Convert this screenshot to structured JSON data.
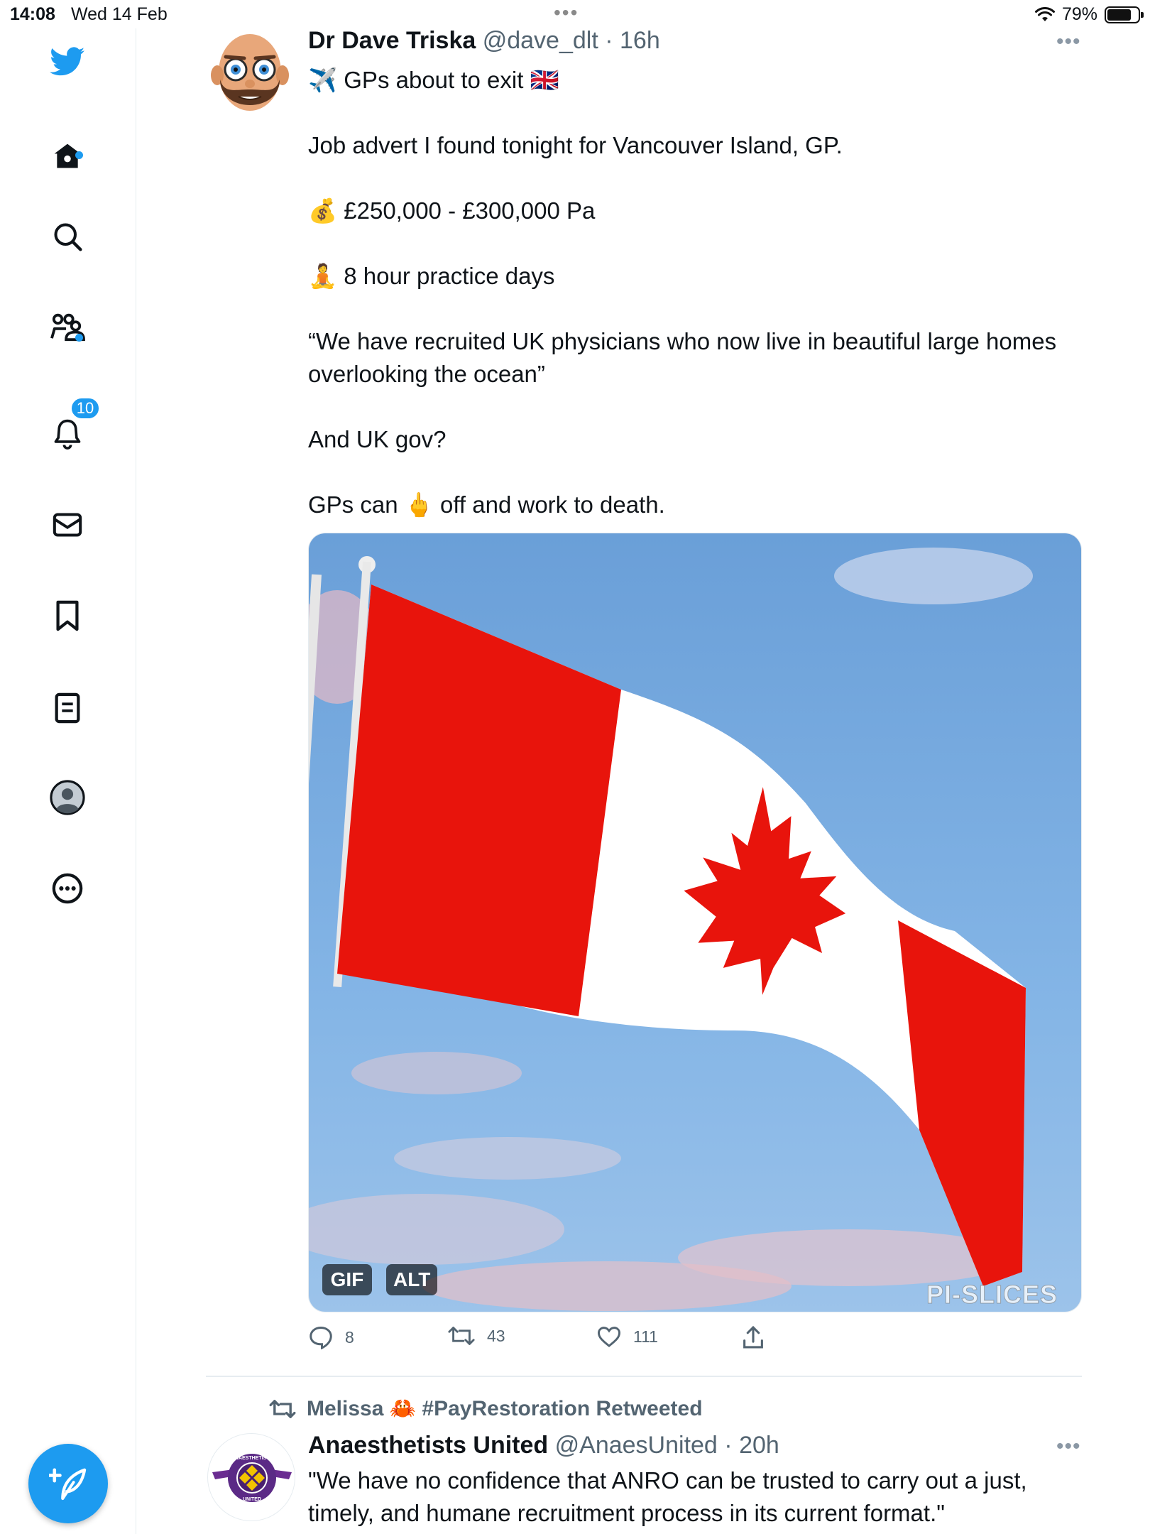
{
  "status_bar": {
    "time": "14:08",
    "date": "Wed 14 Feb",
    "battery": "79%",
    "battery_level": 0.79
  },
  "sidebar": {
    "items": [
      {
        "name": "home",
        "icon": "home-icon"
      },
      {
        "name": "explore",
        "icon": "search-icon"
      },
      {
        "name": "communities",
        "icon": "communities-icon"
      },
      {
        "name": "notifications",
        "icon": "bell-icon",
        "badge": "10"
      },
      {
        "name": "messages",
        "icon": "mail-icon"
      },
      {
        "name": "bookmarks",
        "icon": "bookmark-icon"
      },
      {
        "name": "lists",
        "icon": "list-icon"
      },
      {
        "name": "profile",
        "icon": "profile-icon"
      },
      {
        "name": "more",
        "icon": "more-circle-icon"
      }
    ],
    "accent": "#1d9bf0"
  },
  "tweet1": {
    "name": "Dr Dave Triska",
    "handle": "@dave_dlt",
    "time": "16h",
    "lines": {
      "l1_emoji": "✈️",
      "l1_text": "GPs about to exit",
      "l1_flag": "🇬🇧",
      "l2": "Job advert I found tonight for Vancouver Island, GP.",
      "l3_emoji": "💰",
      "l3_text": "£250,000 - £300,000 Pa",
      "l4_emoji": "🧘",
      "l4_text": "8 hour practice days",
      "l5": "“We have recruited UK physicians who now live in beautiful large homes overlooking the ocean”",
      "l6": "And UK gov?",
      "l7_a": "GPs can",
      "l7_emoji": "🖕",
      "l7_b": "off and work to death."
    },
    "media": {
      "tag_gif": "GIF",
      "tag_alt": "ALT",
      "watermark": "PI-SLICES"
    },
    "stats": {
      "replies": "8",
      "retweets": "43",
      "likes": "111"
    }
  },
  "tweet2": {
    "retweeted_by": "Melissa 🦀 #PayRestoration Retweeted",
    "name": "Anaesthetists United",
    "handle": "@AnaesUnited",
    "time": "20h",
    "text": "\"We have no confidence that ANRO can be trusted to carry out a just, timely, and humane recruitment process in its current format.\"",
    "logo_text_top": "ANAESTHETISTS",
    "logo_text_bottom": "UNITED"
  }
}
